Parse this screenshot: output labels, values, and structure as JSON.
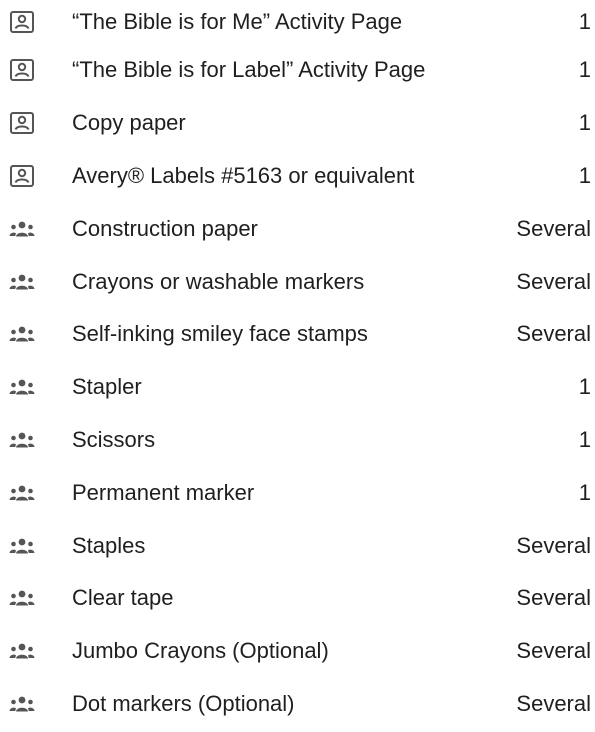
{
  "items": [
    {
      "icon": "portrait-card-icon",
      "label": "“The Bible is for Me” Activity Page",
      "qty": "1"
    },
    {
      "icon": "portrait-card-icon",
      "label": "“The Bible is for Label” Activity Page",
      "qty": "1"
    },
    {
      "icon": "portrait-card-icon",
      "label": "Copy paper",
      "qty": "1"
    },
    {
      "icon": "portrait-card-icon",
      "label": "Avery® Labels #5163 or equivalent",
      "qty": "1"
    },
    {
      "icon": "group-icon",
      "label": "Construction paper",
      "qty": "Several"
    },
    {
      "icon": "group-icon",
      "label": "Crayons or washable markers",
      "qty": "Several"
    },
    {
      "icon": "group-icon",
      "label": "Self-inking smiley face stamps",
      "qty": "Several"
    },
    {
      "icon": "group-icon",
      "label": "Stapler",
      "qty": "1"
    },
    {
      "icon": "group-icon",
      "label": "Scissors",
      "qty": "1"
    },
    {
      "icon": "group-icon",
      "label": "Permanent marker",
      "qty": "1"
    },
    {
      "icon": "group-icon",
      "label": "Staples",
      "qty": "Several"
    },
    {
      "icon": "group-icon",
      "label": "Clear tape",
      "qty": "Several"
    },
    {
      "icon": "group-icon",
      "label": "Jumbo Crayons (Optional)",
      "qty": "Several"
    },
    {
      "icon": "group-icon",
      "label": "Dot markers (Optional)",
      "qty": "Several"
    }
  ],
  "colors": {
    "text": "#1f1f1f",
    "icon": "#555555"
  }
}
